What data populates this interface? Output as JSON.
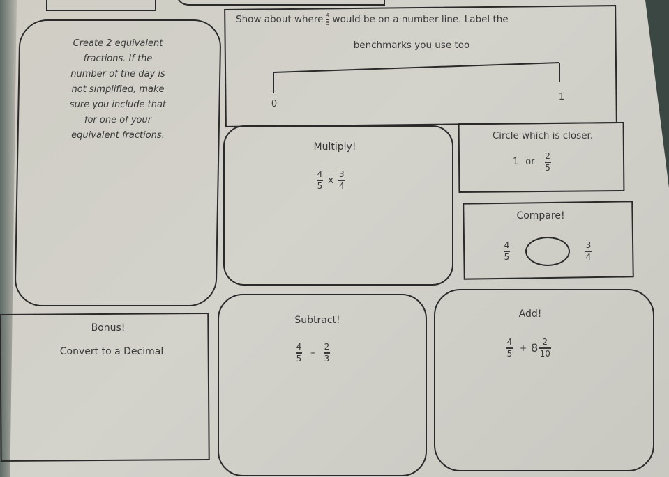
{
  "worksheet": {
    "equivalent_fractions": {
      "instructions": [
        "Create 2 equivalent",
        "fractions. If the",
        "number of the day is",
        "not simplified, make",
        "sure you include that",
        "for one of your",
        "equivalent fractions."
      ]
    },
    "number_line": {
      "prompt_before": "Show about where",
      "fraction": {
        "numerator": "4",
        "denominator": "5"
      },
      "prompt_after": "would be on a number line. Label the",
      "prompt_line2": "benchmarks you use too",
      "start_label": "0",
      "end_label": "1"
    },
    "multiply": {
      "title": "Multiply!",
      "left": {
        "numerator": "4",
        "denominator": "5"
      },
      "operator": "x",
      "right": {
        "numerator": "3",
        "denominator": "4"
      }
    },
    "closer": {
      "title": "Circle which is closer.",
      "option_a": "1",
      "connector": "or",
      "option_b": {
        "numerator": "2",
        "denominator": "5"
      }
    },
    "compare": {
      "title": "Compare!",
      "left": {
        "numerator": "4",
        "denominator": "5"
      },
      "right": {
        "numerator": "3",
        "denominator": "4"
      }
    },
    "bonus": {
      "title": "Bonus!",
      "subtitle": "Convert to a Decimal"
    },
    "subtract": {
      "title": "Subtract!",
      "left": {
        "numerator": "4",
        "denominator": "5"
      },
      "operator": "–",
      "right": {
        "numerator": "2",
        "denominator": "3"
      }
    },
    "add": {
      "title": "Add!",
      "left": {
        "numerator": "4",
        "denominator": "5"
      },
      "operator": "+",
      "whole": "8",
      "right": {
        "numerator": "2",
        "denominator": "10"
      }
    }
  }
}
